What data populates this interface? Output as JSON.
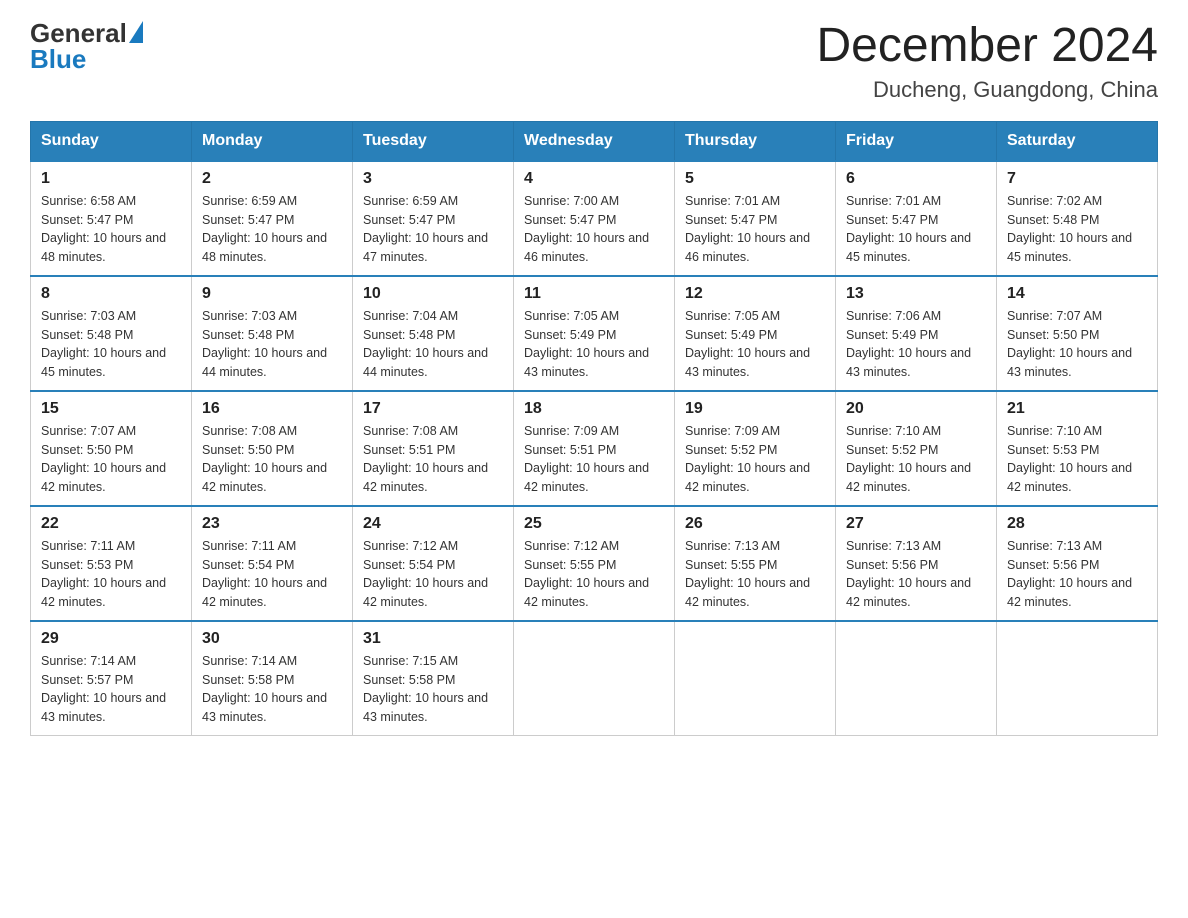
{
  "header": {
    "logo_general": "General",
    "logo_blue": "Blue",
    "month_title": "December 2024",
    "location": "Ducheng, Guangdong, China"
  },
  "days_of_week": [
    "Sunday",
    "Monday",
    "Tuesday",
    "Wednesday",
    "Thursday",
    "Friday",
    "Saturday"
  ],
  "weeks": [
    [
      {
        "day": "1",
        "sunrise": "6:58 AM",
        "sunset": "5:47 PM",
        "daylight": "10 hours and 48 minutes."
      },
      {
        "day": "2",
        "sunrise": "6:59 AM",
        "sunset": "5:47 PM",
        "daylight": "10 hours and 48 minutes."
      },
      {
        "day": "3",
        "sunrise": "6:59 AM",
        "sunset": "5:47 PM",
        "daylight": "10 hours and 47 minutes."
      },
      {
        "day": "4",
        "sunrise": "7:00 AM",
        "sunset": "5:47 PM",
        "daylight": "10 hours and 46 minutes."
      },
      {
        "day": "5",
        "sunrise": "7:01 AM",
        "sunset": "5:47 PM",
        "daylight": "10 hours and 46 minutes."
      },
      {
        "day": "6",
        "sunrise": "7:01 AM",
        "sunset": "5:47 PM",
        "daylight": "10 hours and 45 minutes."
      },
      {
        "day": "7",
        "sunrise": "7:02 AM",
        "sunset": "5:48 PM",
        "daylight": "10 hours and 45 minutes."
      }
    ],
    [
      {
        "day": "8",
        "sunrise": "7:03 AM",
        "sunset": "5:48 PM",
        "daylight": "10 hours and 45 minutes."
      },
      {
        "day": "9",
        "sunrise": "7:03 AM",
        "sunset": "5:48 PM",
        "daylight": "10 hours and 44 minutes."
      },
      {
        "day": "10",
        "sunrise": "7:04 AM",
        "sunset": "5:48 PM",
        "daylight": "10 hours and 44 minutes."
      },
      {
        "day": "11",
        "sunrise": "7:05 AM",
        "sunset": "5:49 PM",
        "daylight": "10 hours and 43 minutes."
      },
      {
        "day": "12",
        "sunrise": "7:05 AM",
        "sunset": "5:49 PM",
        "daylight": "10 hours and 43 minutes."
      },
      {
        "day": "13",
        "sunrise": "7:06 AM",
        "sunset": "5:49 PM",
        "daylight": "10 hours and 43 minutes."
      },
      {
        "day": "14",
        "sunrise": "7:07 AM",
        "sunset": "5:50 PM",
        "daylight": "10 hours and 43 minutes."
      }
    ],
    [
      {
        "day": "15",
        "sunrise": "7:07 AM",
        "sunset": "5:50 PM",
        "daylight": "10 hours and 42 minutes."
      },
      {
        "day": "16",
        "sunrise": "7:08 AM",
        "sunset": "5:50 PM",
        "daylight": "10 hours and 42 minutes."
      },
      {
        "day": "17",
        "sunrise": "7:08 AM",
        "sunset": "5:51 PM",
        "daylight": "10 hours and 42 minutes."
      },
      {
        "day": "18",
        "sunrise": "7:09 AM",
        "sunset": "5:51 PM",
        "daylight": "10 hours and 42 minutes."
      },
      {
        "day": "19",
        "sunrise": "7:09 AM",
        "sunset": "5:52 PM",
        "daylight": "10 hours and 42 minutes."
      },
      {
        "day": "20",
        "sunrise": "7:10 AM",
        "sunset": "5:52 PM",
        "daylight": "10 hours and 42 minutes."
      },
      {
        "day": "21",
        "sunrise": "7:10 AM",
        "sunset": "5:53 PM",
        "daylight": "10 hours and 42 minutes."
      }
    ],
    [
      {
        "day": "22",
        "sunrise": "7:11 AM",
        "sunset": "5:53 PM",
        "daylight": "10 hours and 42 minutes."
      },
      {
        "day": "23",
        "sunrise": "7:11 AM",
        "sunset": "5:54 PM",
        "daylight": "10 hours and 42 minutes."
      },
      {
        "day": "24",
        "sunrise": "7:12 AM",
        "sunset": "5:54 PM",
        "daylight": "10 hours and 42 minutes."
      },
      {
        "day": "25",
        "sunrise": "7:12 AM",
        "sunset": "5:55 PM",
        "daylight": "10 hours and 42 minutes."
      },
      {
        "day": "26",
        "sunrise": "7:13 AM",
        "sunset": "5:55 PM",
        "daylight": "10 hours and 42 minutes."
      },
      {
        "day": "27",
        "sunrise": "7:13 AM",
        "sunset": "5:56 PM",
        "daylight": "10 hours and 42 minutes."
      },
      {
        "day": "28",
        "sunrise": "7:13 AM",
        "sunset": "5:56 PM",
        "daylight": "10 hours and 42 minutes."
      }
    ],
    [
      {
        "day": "29",
        "sunrise": "7:14 AM",
        "sunset": "5:57 PM",
        "daylight": "10 hours and 43 minutes."
      },
      {
        "day": "30",
        "sunrise": "7:14 AM",
        "sunset": "5:58 PM",
        "daylight": "10 hours and 43 minutes."
      },
      {
        "day": "31",
        "sunrise": "7:15 AM",
        "sunset": "5:58 PM",
        "daylight": "10 hours and 43 minutes."
      },
      null,
      null,
      null,
      null
    ]
  ]
}
